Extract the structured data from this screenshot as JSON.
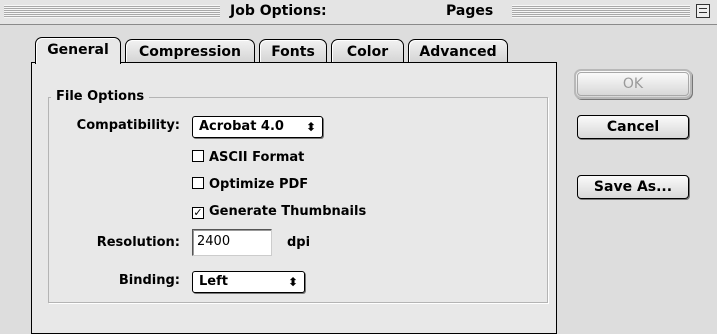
{
  "window": {
    "title": "Job Options:",
    "subtitle": "Pages",
    "zoom_icon": "zoom-box-icon"
  },
  "tabs": [
    {
      "label": "General",
      "active": true
    },
    {
      "label": "Compression",
      "active": false
    },
    {
      "label": "Fonts",
      "active": false
    },
    {
      "label": "Color",
      "active": false
    },
    {
      "label": "Advanced",
      "active": false
    }
  ],
  "file_options": {
    "legend": "File Options",
    "compatibility": {
      "label": "Compatibility:",
      "value": "Acrobat 4.0",
      "arrow_icon": "updown-arrow-icon"
    },
    "checkboxes": [
      {
        "label": "ASCII Format",
        "checked": false
      },
      {
        "label": "Optimize PDF",
        "checked": false
      },
      {
        "label": "Generate Thumbnails",
        "checked": true
      }
    ],
    "resolution": {
      "label": "Resolution:",
      "value": "2400",
      "unit": "dpi"
    },
    "binding": {
      "label": "Binding:",
      "value": "Left",
      "arrow_icon": "updown-arrow-icon"
    }
  },
  "buttons": {
    "ok": {
      "label": "OK",
      "enabled": false
    },
    "cancel": {
      "label": "Cancel"
    },
    "save_as": {
      "label": "Save As..."
    }
  },
  "cursor_icon": "arrow-cursor-icon"
}
